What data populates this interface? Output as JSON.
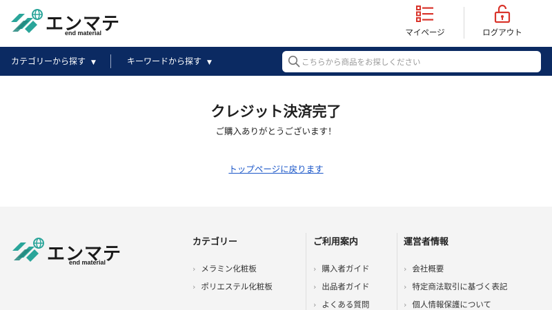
{
  "brand": {
    "name": "エンマテ",
    "sub": "end material",
    "colors": {
      "accent": "#2aa59a",
      "navy": "#0b2a62",
      "red": "#d9342b"
    }
  },
  "header": {
    "mypage_label": "マイページ",
    "logout_label": "ログアウト",
    "icons": {
      "mypage": "list-icon",
      "logout": "unlock-icon"
    }
  },
  "nav": {
    "category_label": "カテゴリーから探す",
    "keyword_label": "キーワードから探す",
    "caret": "▼",
    "search": {
      "placeholder": "こちらから商品をお探しください",
      "value": ""
    }
  },
  "main": {
    "title": "クレジット決済完了",
    "message": "ご購入ありがとうございます！",
    "back_link": "トップページに戻ります"
  },
  "footer": {
    "columns": [
      {
        "title": "カテゴリー",
        "items": [
          "メラミン化粧板",
          "ポリエステル化粧板"
        ]
      },
      {
        "title": "ご利用案内",
        "items": [
          "購入者ガイド",
          "出品者ガイド",
          "よくある質問"
        ]
      },
      {
        "title": "運営者情報",
        "items": [
          "会社概要",
          "特定商法取引に基づく表記",
          "個人情報保護について"
        ]
      }
    ],
    "chevron": "›"
  }
}
